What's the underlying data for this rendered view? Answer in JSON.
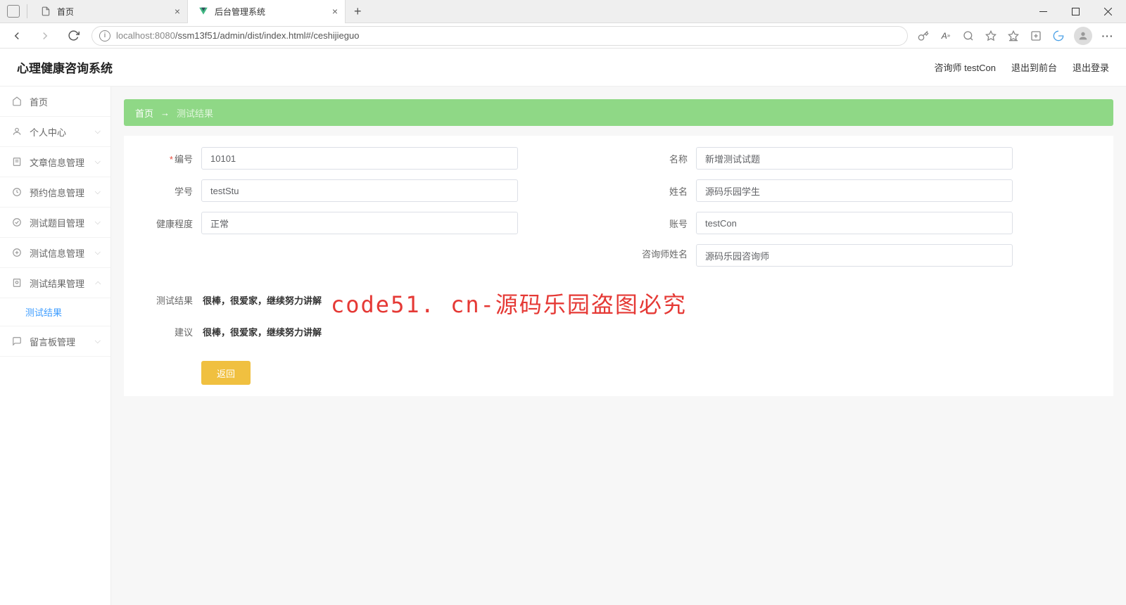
{
  "browser": {
    "tabs": [
      {
        "title": "首页",
        "icon": "page"
      },
      {
        "title": "后台管理系统",
        "icon": "vue"
      }
    ],
    "url_host": "localhost",
    "url_port": ":8080",
    "url_path": "/ssm13f51/admin/dist/index.html#/ceshijieguo"
  },
  "header": {
    "app_title": "心理健康咨询系统",
    "user_label": "咨询师 testCon",
    "logout_front": "退出到前台",
    "logout": "退出登录"
  },
  "sidebar": {
    "items": [
      {
        "label": "首页",
        "icon": "home",
        "arrow": false
      },
      {
        "label": "个人中心",
        "icon": "user",
        "arrow": true,
        "dir": "down"
      },
      {
        "label": "文章信息管理",
        "icon": "doc",
        "arrow": true,
        "dir": "down"
      },
      {
        "label": "预约信息管理",
        "icon": "clock",
        "arrow": true,
        "dir": "down"
      },
      {
        "label": "测试题目管理",
        "icon": "check",
        "arrow": true,
        "dir": "down"
      },
      {
        "label": "测试信息管理",
        "icon": "plus",
        "arrow": true,
        "dir": "down"
      },
      {
        "label": "测试结果管理",
        "icon": "result",
        "arrow": true,
        "dir": "up"
      },
      {
        "label": "留言板管理",
        "icon": "msg",
        "arrow": true,
        "dir": "down"
      }
    ],
    "active_sub": "测试结果"
  },
  "breadcrumb": {
    "home": "首页",
    "current": "测试结果"
  },
  "form": {
    "id_label": "编号",
    "id_value": "10101",
    "name_label": "名称",
    "name_value": "新增测试试题",
    "stuno_label": "学号",
    "stuno_value": "testStu",
    "stuname_label": "姓名",
    "stuname_value": "源码乐园学生",
    "health_label": "健康程度",
    "health_value": "正常",
    "account_label": "账号",
    "account_value": "testCon",
    "consultant_label": "咨询师姓名",
    "consultant_value": "源码乐园咨询师",
    "result_label": "测试结果",
    "result_value": "很棒，很爱家，继续努力讲解",
    "advice_label": "建议",
    "advice_value": "很棒，很爱家，继续努力讲解",
    "back_btn": "返回"
  },
  "watermark": "code51. cn-源码乐园盗图必究"
}
